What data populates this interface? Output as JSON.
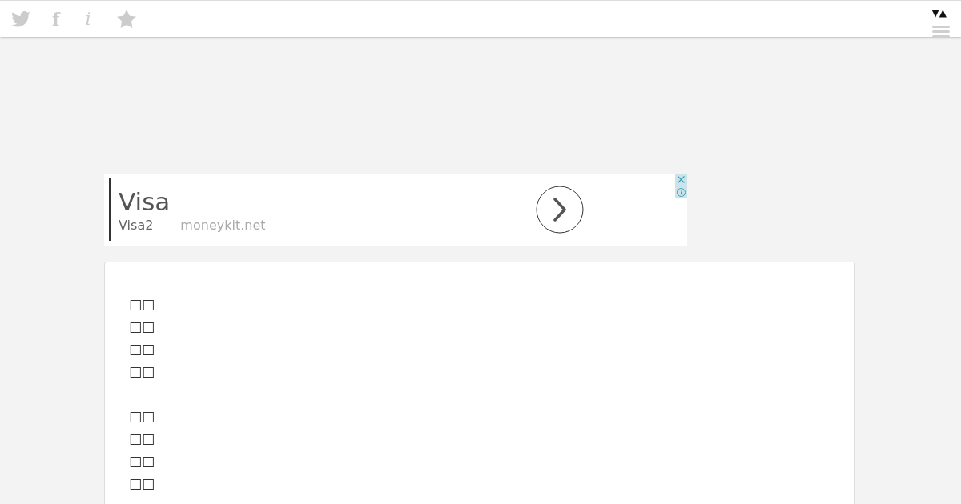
{
  "header": {
    "share_letter": "f",
    "info_letter": "i",
    "toggle": "▼▲"
  },
  "ad": {
    "title": "Visa",
    "subtitle": "Visa2",
    "domain": "moneykit.net"
  },
  "article": {
    "paragraphs": [
      "□□\n□□\n□□\n□□",
      "□□\n□□\n□□\n□□"
    ]
  }
}
